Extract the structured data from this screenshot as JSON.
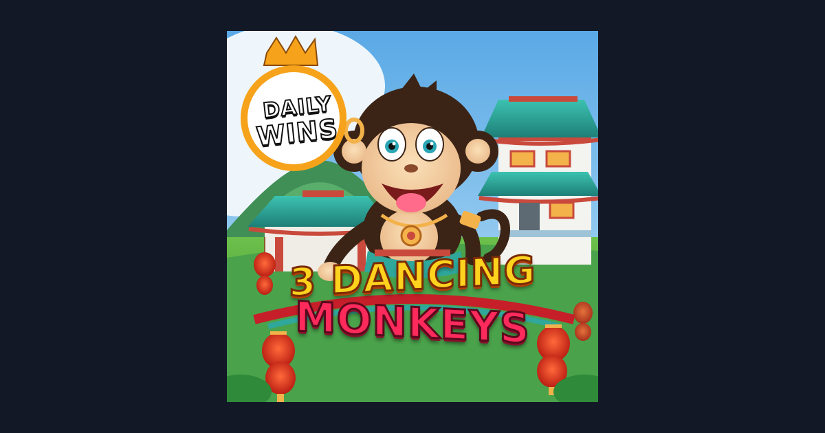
{
  "game": {
    "title_line1": "3 DANCING",
    "title_line2": "MONKEYS"
  },
  "badge": {
    "line1": "DAILY",
    "line2": "WINS",
    "crown_color": "#f6a31b"
  },
  "colors": {
    "page_background": "#131826",
    "sky": "#6fb8e6",
    "title_yellow": "#ffd21e",
    "title_red": "#ff2a5c",
    "roof_teal": "#2fa79b",
    "lantern_red": "#d8231c"
  },
  "icons": {
    "crown": "crown-icon",
    "mascot": "monkey-mascot",
    "lanterns": "chinese-lantern-icon"
  }
}
